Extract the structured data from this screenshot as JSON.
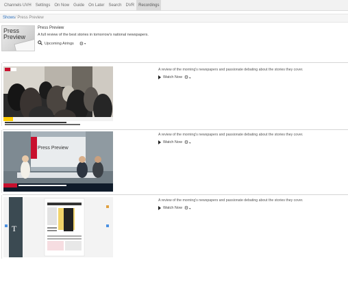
{
  "nav": {
    "items": [
      {
        "label": "Channels UVH",
        "active": false
      },
      {
        "label": "Settings",
        "active": false
      },
      {
        "label": "On Now",
        "active": false
      },
      {
        "label": "Guide",
        "active": false
      },
      {
        "label": "On Later",
        "active": false
      },
      {
        "label": "Search",
        "active": false
      },
      {
        "label": "DVR",
        "active": false
      },
      {
        "label": "Recordings",
        "active": true
      }
    ]
  },
  "breadcrumb": {
    "root": "Shows",
    "separator": "/",
    "current": "Press Preview"
  },
  "show": {
    "logo_text": "Press Preview",
    "title": "Press Preview",
    "description": "A full review of the best stories in tomorrow's national newspapers.",
    "upcoming_label": "Upcoming Airings",
    "icons": {
      "search": "search-icon",
      "settings": "gear-icon"
    }
  },
  "episodes": [
    {
      "description": "A review of the morning's newspapers and passionate debating about the stories they cover.",
      "watch_label": "Watch Now",
      "thumb_type": "crowd-scene"
    },
    {
      "description": "A review of the morning's newspapers and passionate debating about the stories they cover.",
      "watch_label": "Watch Now",
      "thumb_type": "studio-panel"
    },
    {
      "description": "A review of the morning's newspapers and passionate debating about the stories they cover.",
      "watch_label": "Watch Now",
      "thumb_type": "newspaper-page"
    }
  ],
  "colors": {
    "link": "#2a6ebb",
    "nav_bg": "#f2f2f2",
    "active_tab": "#dadada"
  }
}
